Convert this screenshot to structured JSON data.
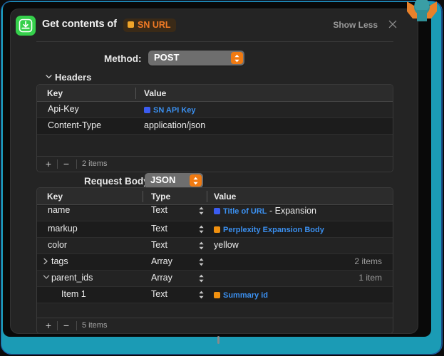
{
  "window": {
    "accent_teal": "#1b9bb5",
    "card_bg": "#242424",
    "app_icon_color": "#35d04b",
    "token_orange": "#f07a25",
    "token_blue": "#3b90f0"
  },
  "header": {
    "app_icon": "download-to-tray-icon",
    "title": "Get contents of",
    "url_token": {
      "chip": "orange-square-icon",
      "label": "SN URL"
    },
    "show_less_label": "Show Less",
    "close_icon": "close-icon"
  },
  "method": {
    "label": "Method:",
    "value": "POST",
    "stepper_icon": "stepper-up-down-icon"
  },
  "headers_section": {
    "disclosure_label": "Headers",
    "expanded": true,
    "columns": [
      "Key",
      "Value"
    ],
    "rows": [
      {
        "key": "Api-Key",
        "value_token": {
          "chip": "blue-square-icon",
          "label": "SN API Key"
        },
        "value_text": ""
      },
      {
        "key": "Content-Type",
        "value_token": null,
        "value_text": "application/json"
      }
    ],
    "footer": {
      "add_label": "+",
      "remove_label": "−",
      "count_label": "2 items"
    }
  },
  "request_body": {
    "label": "Request Body:",
    "value": "JSON",
    "stepper_icon": "stepper-up-down-icon",
    "columns": [
      "Key",
      "Type",
      "Value"
    ],
    "rows": [
      {
        "key": "name",
        "indent": 0,
        "disclosure": "",
        "type": "Text",
        "value_token": {
          "chip": "blue-square-icon",
          "label": "Title of URL"
        },
        "value_text": " - Expansion",
        "count": ""
      },
      {
        "key": "markup",
        "indent": 0,
        "disclosure": "",
        "type": "Text",
        "value_token": {
          "chip": "orange-square-icon",
          "label": "Perplexity Expansion Body"
        },
        "value_text": "",
        "count": ""
      },
      {
        "key": "color",
        "indent": 0,
        "disclosure": "",
        "type": "Text",
        "value_token": null,
        "value_text": "yellow",
        "count": ""
      },
      {
        "key": "tags",
        "indent": 0,
        "disclosure": "collapsed",
        "type": "Array",
        "value_token": null,
        "value_text": "",
        "count": "2 items"
      },
      {
        "key": "parent_ids",
        "indent": 0,
        "disclosure": "expanded",
        "type": "Array",
        "value_token": null,
        "value_text": "",
        "count": "1 item"
      },
      {
        "key": "Item 1",
        "indent": 1,
        "disclosure": "",
        "type": "Text",
        "value_token": {
          "chip": "orange-square-icon",
          "label": "Summary id"
        },
        "value_text": "",
        "count": ""
      }
    ],
    "footer": {
      "add_label": "+",
      "remove_label": "−",
      "count_label": "5 items"
    }
  },
  "decor": {
    "mascot_icon": "rocket-mascot-icon",
    "scroll_thumb": "horizontal-scroll-thumb"
  }
}
